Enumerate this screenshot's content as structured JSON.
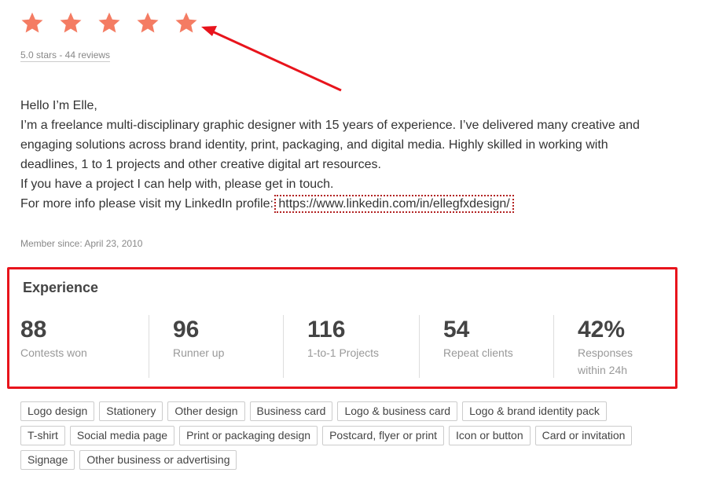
{
  "rating": {
    "stars": 5,
    "max_stars": 5,
    "star_color": "#f47c63",
    "summary": "5.0 stars - 44 reviews"
  },
  "bio": {
    "line1": "Hello I’m Elle,",
    "line2": "I’m a freelance multi-disciplinary graphic designer with 15 years of experience. I’ve delivered many creative and engaging solutions across brand identity, print, packaging, and digital media. Highly skilled in working with deadlines, 1 to 1 projects and other creative digital art resources.",
    "line3": "If you have a project I can help with, please get in touch.",
    "line4_prefix": "For more info please visit my LinkedIn profile:",
    "link_text": "https://www.linkedin.com/in/ellegfxdesign/"
  },
  "member_since": "Member since: April 23, 2010",
  "experience": {
    "title": "Experience",
    "highlight_color": "#e8141c",
    "stats": [
      {
        "value": "88",
        "label": "Contests won"
      },
      {
        "value": "96",
        "label": "Runner up"
      },
      {
        "value": "116",
        "label": "1-to-1 Projects"
      },
      {
        "value": "54",
        "label": "Repeat clients"
      },
      {
        "value": "42%",
        "label": "Responses within 24h"
      }
    ]
  },
  "tags": [
    "Logo design",
    "Stationery",
    "Other design",
    "Business card",
    "Logo & business card",
    "Logo & brand identity pack",
    "T-shirt",
    "Social media page",
    "Print or packaging design",
    "Postcard, flyer or print",
    "Icon or button",
    "Card or invitation",
    "Signage",
    "Other business or advertising"
  ]
}
